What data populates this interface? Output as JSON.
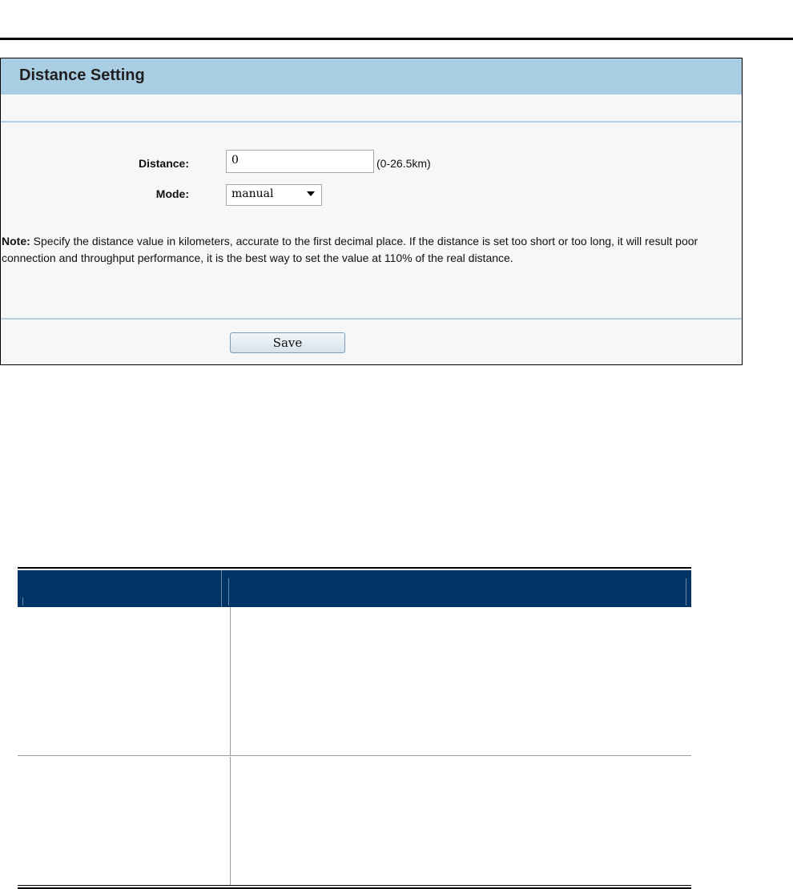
{
  "panel": {
    "title": "Distance Setting",
    "distance_label": "Distance:",
    "distance_value": "0",
    "distance_range": "(0-26.5km)",
    "mode_label": "Mode:",
    "mode_value": "manual",
    "note_prefix": "Note:",
    "note_text": " Specify the distance value in kilometers, accurate to the first decimal place. If the distance is set too short or too long, it will result poor connection and throughput performance, it is the best way to set the value at 110% of the real distance.",
    "save_label": "Save"
  },
  "colors": {
    "header_bar": "#a9cde3",
    "table_header": "#003366"
  }
}
